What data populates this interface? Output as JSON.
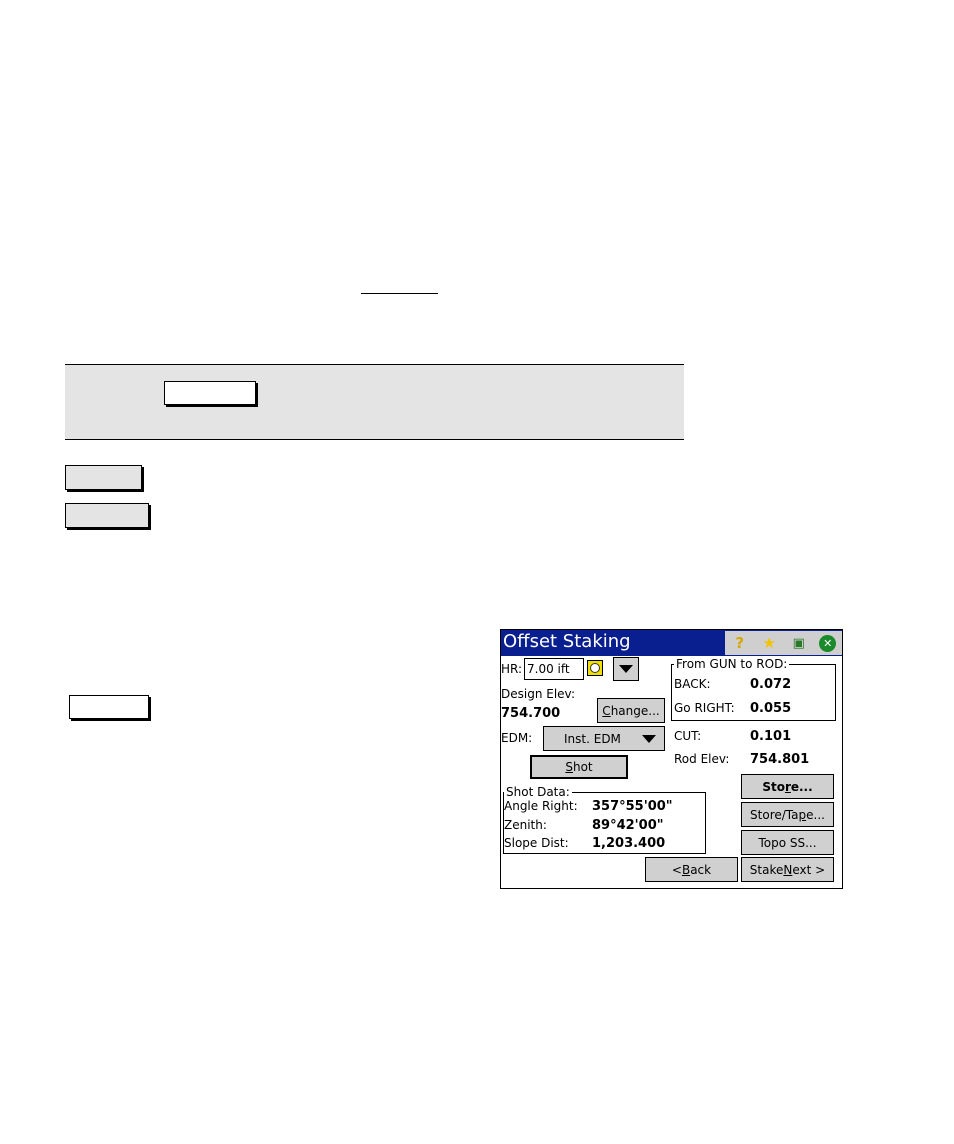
{
  "document": {
    "keycaps": [
      "",
      "",
      "",
      ""
    ]
  },
  "device": {
    "title": "Offset Staking",
    "title_icons": [
      "help-icon",
      "favorites-star-icon",
      "clipboard-check-icon",
      "close-icon"
    ],
    "hr_label": "HR:",
    "hr_value": "7.00 ift",
    "design_elev_label": "Design Elev:",
    "design_elev_value": "754.700",
    "change_button": {
      "pre": "",
      "accel": "C",
      "post": "hange..."
    },
    "edm_label": "EDM:",
    "edm_value": "Inst. EDM",
    "shot_button": {
      "accel": "S",
      "post": "hot"
    },
    "gun_to_rod": {
      "legend": "From GUN to ROD:",
      "back_label": "BACK:",
      "back_value": "0.072",
      "right_label": "Go RIGHT:",
      "right_value": "0.055"
    },
    "cut_label": "CUT:",
    "cut_value": "0.101",
    "rod_elev_label": "Rod Elev:",
    "rod_elev_value": "754.801",
    "shot_data": {
      "legend": "Shot Data:",
      "rows": [
        {
          "label": "Angle Right:",
          "value": "357°55'00\""
        },
        {
          "label": "Zenith:",
          "value": "89°42'00\""
        },
        {
          "label": "Slope Dist:",
          "value": "1,203.400"
        }
      ]
    },
    "store_button": {
      "pre": "Sto",
      "accel": "r",
      "post": "e..."
    },
    "store_tape_button": {
      "pre": "Store/Ta",
      "accel": "p",
      "post": "e..."
    },
    "topo_button": "Topo SS...",
    "back_button": {
      "pre": "< ",
      "accel": "B",
      "post": "ack"
    },
    "stake_next_button": {
      "pre": "Stake ",
      "accel": "N",
      "post": "ext >"
    }
  }
}
